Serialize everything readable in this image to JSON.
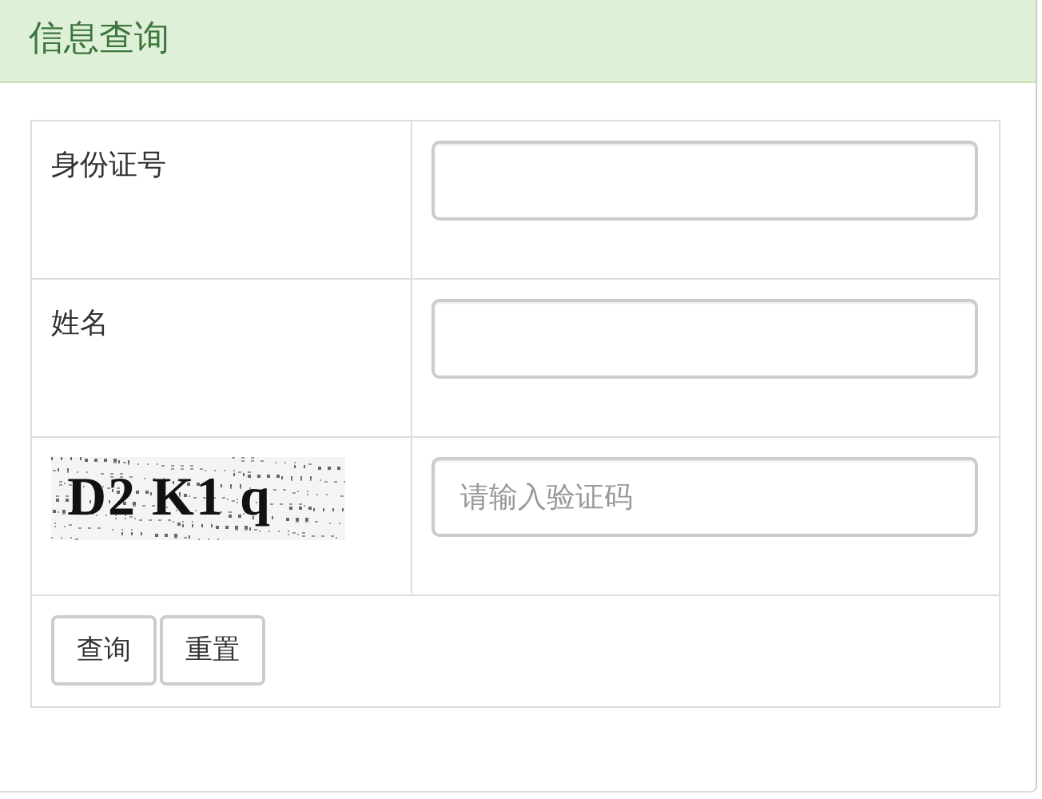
{
  "panel": {
    "title": "信息查询"
  },
  "form": {
    "fields": [
      {
        "kind": "text",
        "label": "身份证号"
      },
      {
        "kind": "text",
        "label": "姓名"
      },
      {
        "kind": "captcha",
        "captcha_code": "D2 K1 q",
        "placeholder": "请输入验证码"
      }
    ],
    "buttons": [
      "查询",
      "重置"
    ]
  }
}
